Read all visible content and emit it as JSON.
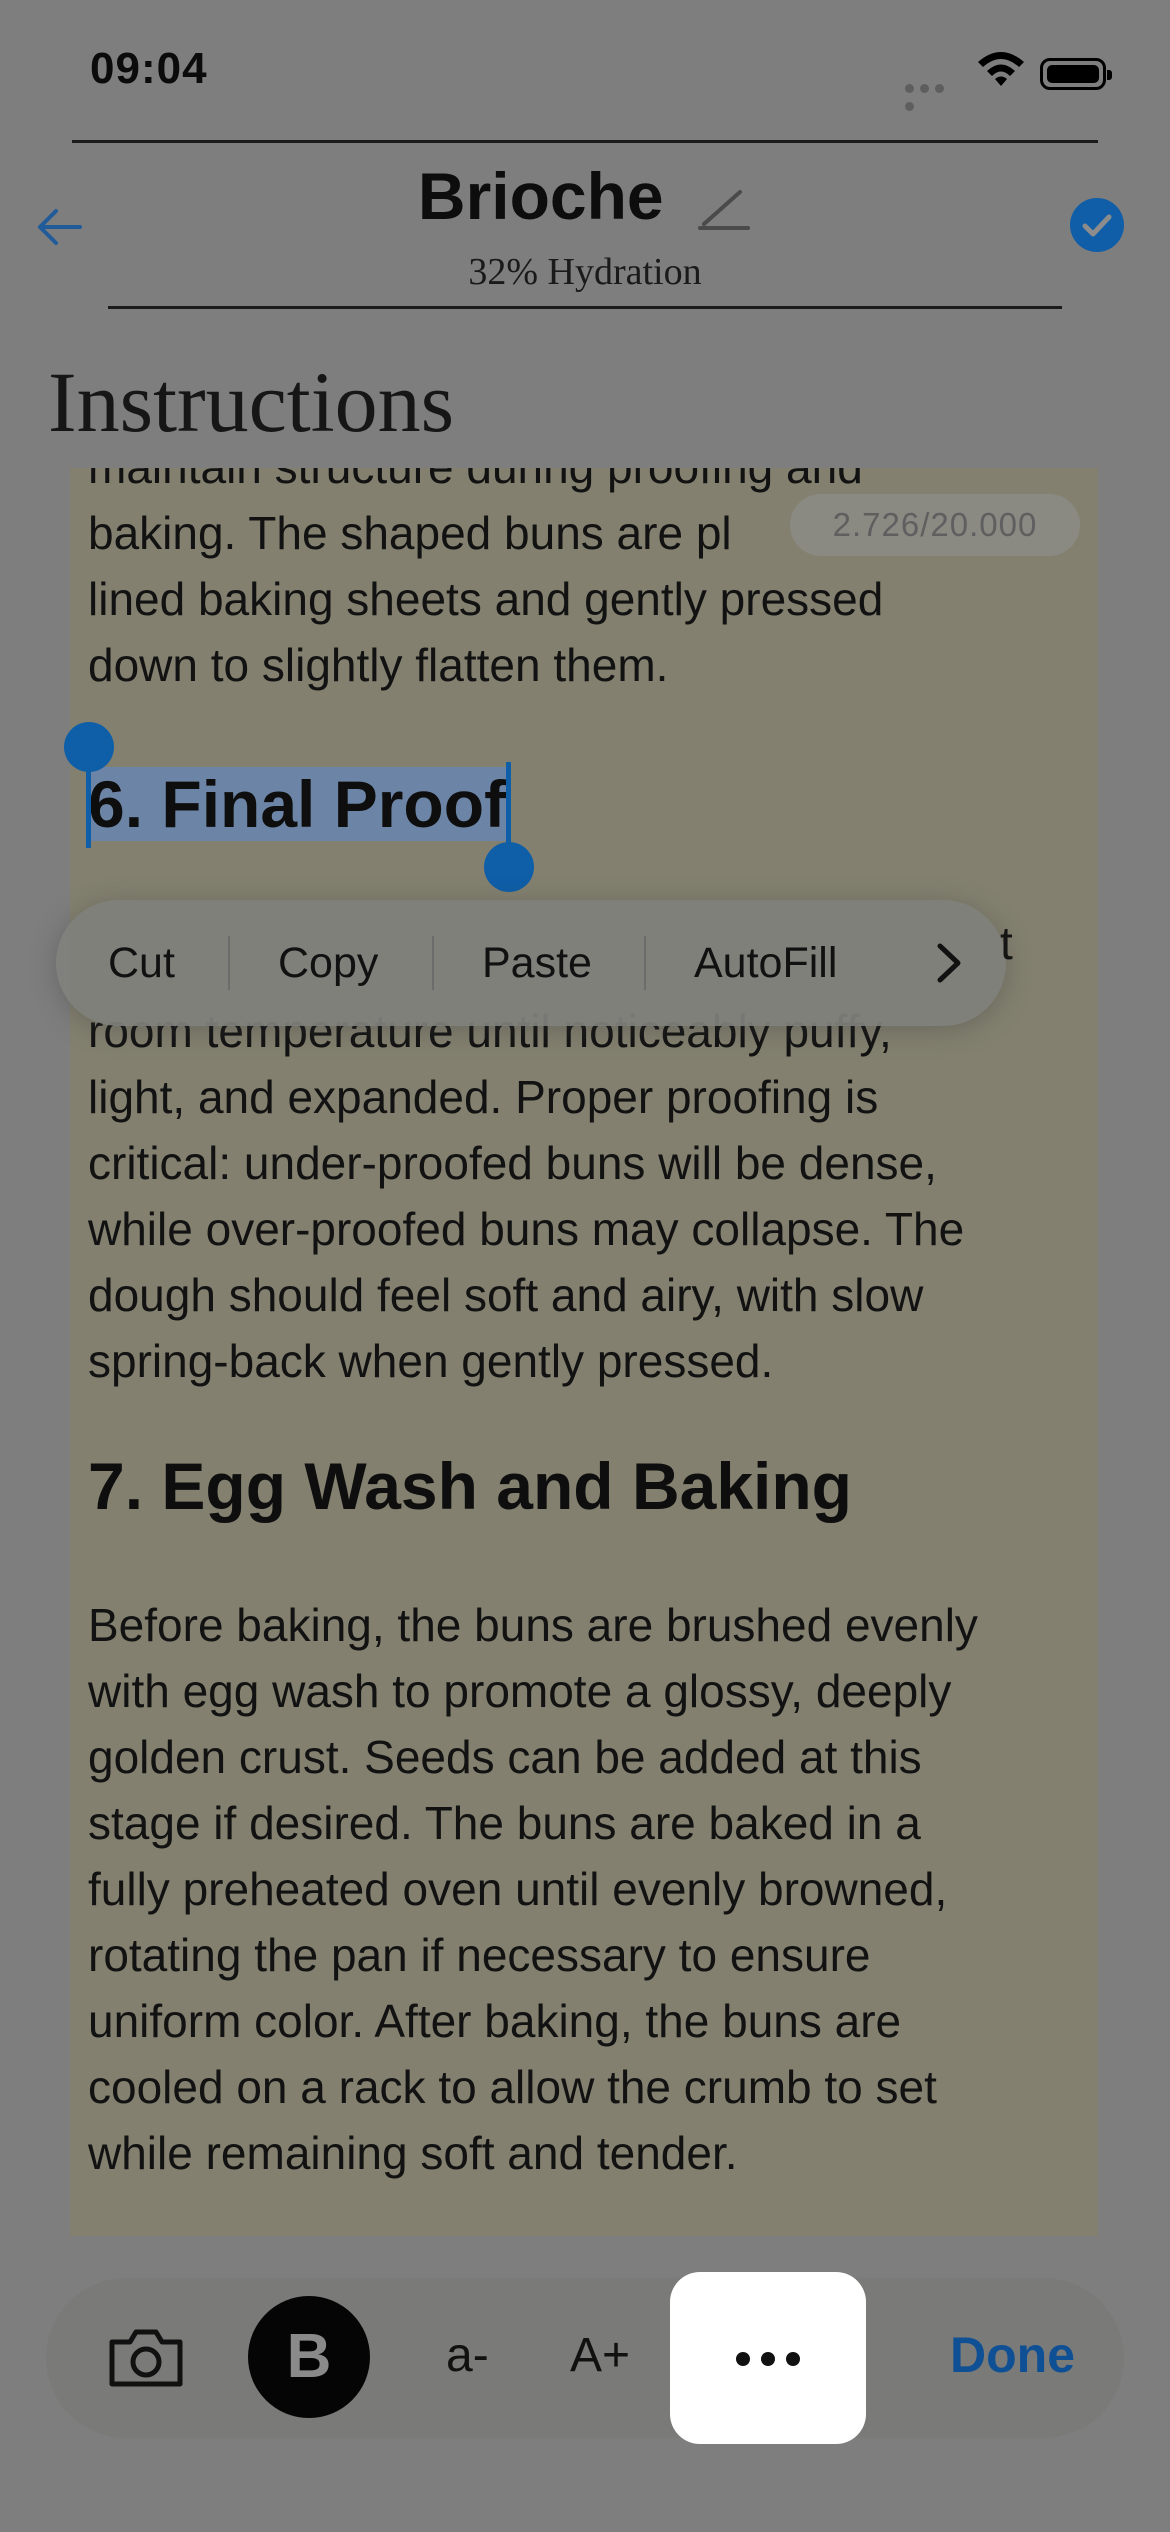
{
  "status_bar": {
    "time": "09:04"
  },
  "header": {
    "title": "Brioche",
    "subtitle": "32% Hydration"
  },
  "section_title": "Instructions",
  "counter": "2.726/20.000",
  "content": {
    "para1_lines": [
      "maintain structure during proofing and",
      "baking. The shaped buns are pl",
      "lined baking sheets and gently pressed",
      "down to slightly flatten them."
    ],
    "heading6": "6. Final Proof",
    "para2_lines": [
      "room temperature until noticeably puffy,",
      "light, and expanded. Proper proofing is",
      "critical: under-proofed buns will be dense,",
      "while over-proofed buns may collapse. The",
      "dough should feel soft and airy, with slow",
      "spring-back when gently pressed."
    ],
    "heading7": "7. Egg Wash and Baking",
    "para3_lines": [
      "Before baking, the buns are brushed evenly",
      "with egg wash to promote a glossy, deeply",
      "golden crust. Seeds can be added at this",
      "stage if desired. The buns are baked in a",
      "fully preheated oven until evenly browned,",
      "rotating the pan if necessary to ensure",
      "uniform color. After baking, the buns are",
      "cooled on a rack to allow the crumb to set",
      "while remaining soft and tender."
    ]
  },
  "context_menu": {
    "items": [
      "Cut",
      "Copy",
      "Paste",
      "AutoFill"
    ],
    "more_icon": "chevron-right-icon",
    "trailing_text": "t"
  },
  "toolbar": {
    "camera_icon": "camera-icon",
    "bold_label": "B",
    "decrease_label": "a-",
    "increase_label": "A+",
    "more_icon": "ellipsis-icon",
    "done_label": "Done"
  },
  "colors": {
    "accent": "#105ea8",
    "selection": "#6c85a6",
    "done": "#0f4f94"
  }
}
